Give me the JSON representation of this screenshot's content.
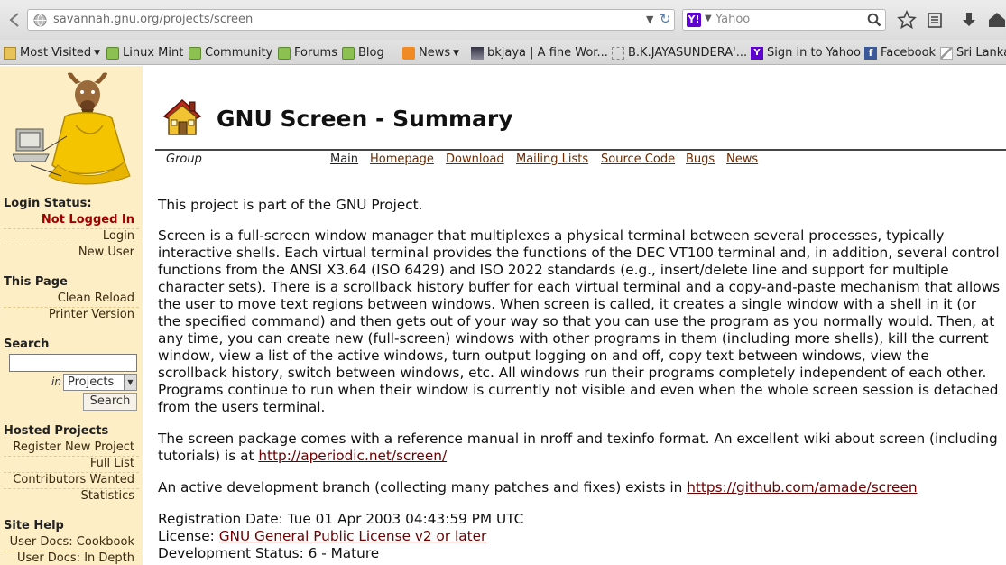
{
  "browser": {
    "url": "savannah.gnu.org/projects/screen",
    "search_placeholder": "Yahoo",
    "search_engine_letter": "Y!",
    "bookmarks": [
      {
        "label": "Most Visited",
        "icon": "folder-icon",
        "dropdown": true
      },
      {
        "label": "Linux Mint",
        "icon": "mint-icon"
      },
      {
        "label": "Community",
        "icon": "mint-icon"
      },
      {
        "label": "Forums",
        "icon": "mint-icon"
      },
      {
        "label": "Blog",
        "icon": "mint-icon"
      },
      {
        "label": "News",
        "icon": "rss-icon",
        "dropdown": true
      },
      {
        "label": "bkjaya | A fine Wor...",
        "icon": "image-icon"
      },
      {
        "label": "B.K.JAYASUNDERA'...",
        "icon": "page-icon"
      },
      {
        "label": "Sign in to Yahoo",
        "icon": "yahoo-icon"
      },
      {
        "label": "Facebook",
        "icon": "facebook-icon"
      },
      {
        "label": "Sri Lanka",
        "icon": "flag-icon"
      }
    ]
  },
  "sidebar": {
    "login_status_heading": "Login Status:",
    "not_logged_in": "Not Logged In",
    "login": "Login",
    "new_user": "New User",
    "this_page_heading": "This Page",
    "clean_reload": "Clean Reload",
    "printer_version": "Printer Version",
    "search_heading": "Search",
    "search_in": "in",
    "search_scope": "Projects",
    "search_button": "Search",
    "hosted_heading": "Hosted Projects",
    "register_new": "Register New Project",
    "full_list": "Full List",
    "contributors_wanted": "Contributors Wanted",
    "statistics": "Statistics",
    "site_help_heading": "Site Help",
    "cookbook": "User Docs: Cookbook",
    "in_depth": "User Docs: In Depth"
  },
  "main": {
    "title": "GNU Screen - Summary",
    "group_label": "Group",
    "tabs": [
      "Main",
      "Homepage",
      "Download",
      "Mailing Lists",
      "Source Code",
      "Bugs",
      "News"
    ],
    "gnu_project": "This project is part of the GNU Project.",
    "description": "Screen is a full-screen window manager that multiplexes a physical terminal between several processes, typically interactive shells. Each virtual terminal provides the functions of the DEC VT100 terminal and, in addition, several control functions from the ANSI X3.64 (ISO 6429) and ISO 2022 standards (e.g., insert/delete line and support for multiple character sets). There is a scrollback history buffer for each virtual terminal and a copy-and-paste mechanism that allows the user to move text regions between windows. When screen is called, it creates a single window with a shell in it (or the specified command) and then gets out of your way so that you can use the program as you normally would. Then, at any time, you can create new (full-screen) windows with other programs in them (including more shells), kill the current window, view a list of the active windows, turn output logging on and off, copy text between windows, view the scrollback history, switch between windows, etc. All windows run their programs completely independent of each other. Programs continue to run when their window is currently not visible and even when the whole screen session is detached from the users terminal.",
    "manual_text": "The screen package comes with a reference manual in nroff and texinfo format. An excellent wiki about screen (including tutorials) is at ",
    "manual_link": "http://aperiodic.net/screen/",
    "dev_text": "An active development branch (collecting many patches and fixes) exists in ",
    "dev_link": "https://github.com/amade/screen",
    "registration": "Registration Date: Tue 01 Apr 2003 04:43:59 PM UTC",
    "license_label": "License: ",
    "license_link": "GNU General Public License v2 or later",
    "dev_status": "Development Status: 6 - Mature"
  },
  "colors": {
    "sidebar_bg": "#fdeec5",
    "link": "#6b0000",
    "not_logged_in": "#a00000"
  }
}
